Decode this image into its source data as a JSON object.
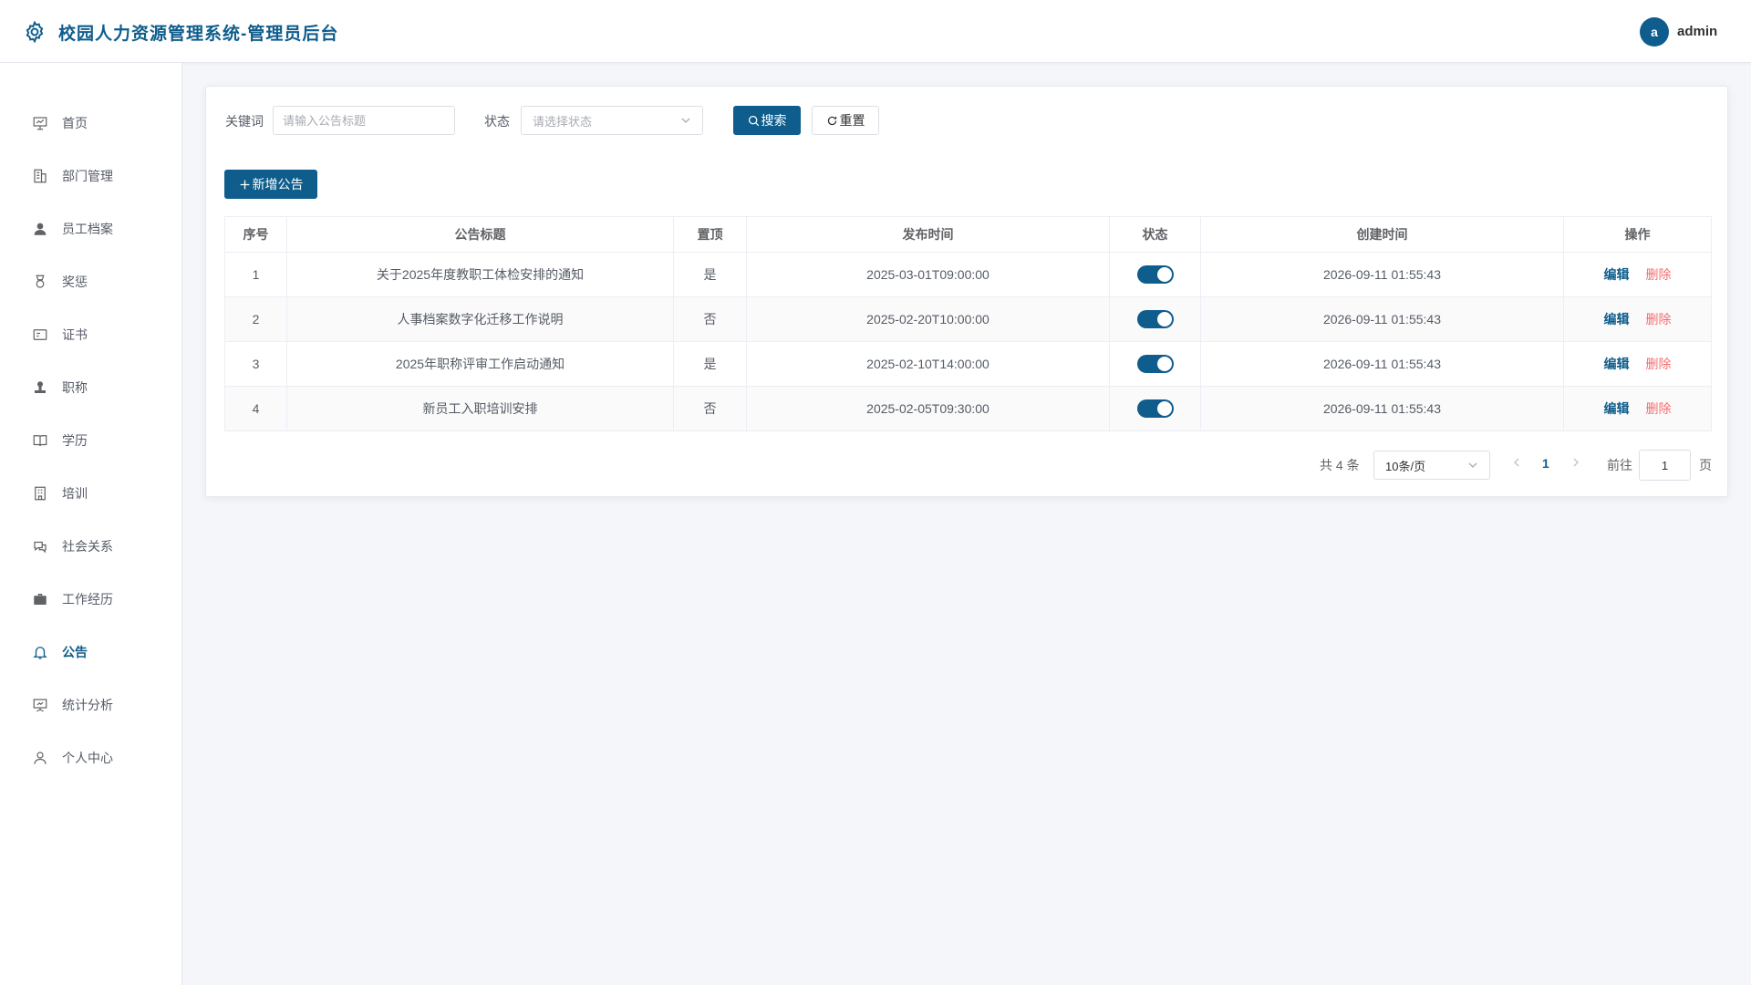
{
  "header": {
    "title": "校园人力资源管理系统-管理员后台",
    "avatar_letter": "a",
    "username": "admin",
    "accent_color": "#0e5d8c"
  },
  "sidebar": {
    "items": [
      {
        "label": "首页",
        "icon": "dashboard-icon"
      },
      {
        "label": "部门管理",
        "icon": "building-icon"
      },
      {
        "label": "员工档案",
        "icon": "user-icon"
      },
      {
        "label": "奖惩",
        "icon": "medal-icon"
      },
      {
        "label": "证书",
        "icon": "certificate-icon"
      },
      {
        "label": "职称",
        "icon": "stamp-icon"
      },
      {
        "label": "学历",
        "icon": "book-icon"
      },
      {
        "label": "培训",
        "icon": "office-icon"
      },
      {
        "label": "社会关系",
        "icon": "chat-icon"
      },
      {
        "label": "工作经历",
        "icon": "briefcase-icon"
      },
      {
        "label": "公告",
        "icon": "bell-icon",
        "active": true
      },
      {
        "label": "统计分析",
        "icon": "presentation-icon"
      },
      {
        "label": "个人中心",
        "icon": "person-icon"
      }
    ]
  },
  "filters": {
    "keyword_label": "关键词",
    "keyword_placeholder": "请输入公告标题",
    "keyword_value": "",
    "status_label": "状态",
    "status_placeholder": "请选择状态",
    "search_label": "搜索",
    "reset_label": "重置"
  },
  "actions": {
    "add_label": "新增公告"
  },
  "table": {
    "columns": [
      "序号",
      "公告标题",
      "置顶",
      "发布时间",
      "状态",
      "创建时间",
      "操作"
    ],
    "rows": [
      {
        "index": "1",
        "title": "关于2025年度教职工体检安排的通知",
        "pinned": "是",
        "publish_time": "2025-03-01T09:00:00",
        "status_on": true,
        "created_time": "2026-09-11 01:55:43"
      },
      {
        "index": "2",
        "title": "人事档案数字化迁移工作说明",
        "pinned": "否",
        "publish_time": "2025-02-20T10:00:00",
        "status_on": true,
        "created_time": "2026-09-11 01:55:43"
      },
      {
        "index": "3",
        "title": "2025年职称评审工作启动通知",
        "pinned": "是",
        "publish_time": "2025-02-10T14:00:00",
        "status_on": true,
        "created_time": "2026-09-11 01:55:43"
      },
      {
        "index": "4",
        "title": "新员工入职培训安排",
        "pinned": "否",
        "publish_time": "2025-02-05T09:30:00",
        "status_on": true,
        "created_time": "2026-09-11 01:55:43"
      }
    ],
    "edit_label": "编辑",
    "delete_label": "删除"
  },
  "pagination": {
    "total_text": "共 4 条",
    "page_size": "10条/页",
    "current_page": "1",
    "goto_label": "前往",
    "goto_value": "1",
    "page_unit": "页"
  }
}
